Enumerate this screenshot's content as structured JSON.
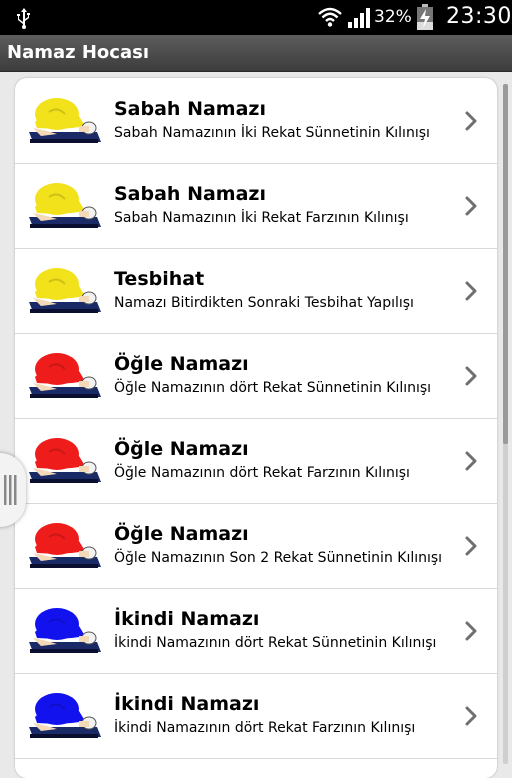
{
  "status_bar": {
    "battery_percent": "32%",
    "time": "23:30",
    "icons": [
      "usb-icon",
      "wifi-icon",
      "signal-icon",
      "battery-charging-icon"
    ]
  },
  "app_title": "Namaz Hocası",
  "colors": {
    "sabah": "#f2e21c",
    "ogle": "#ef1c1c",
    "ikindi": "#1212ee"
  },
  "items": [
    {
      "title": "Sabah Namazı",
      "subtitle": "Sabah Namazının İki Rekat Sünnetinin Kılınışı",
      "color": "#f2e21c"
    },
    {
      "title": "Sabah Namazı",
      "subtitle": "Sabah Namazının İki Rekat Farzının Kılınışı",
      "color": "#f2e21c"
    },
    {
      "title": "Tesbihat",
      "subtitle": "Namazı Bitirdikten Sonraki Tesbihat Yapılışı",
      "color": "#f2e21c"
    },
    {
      "title": "Öğle Namazı",
      "subtitle": "Öğle Namazının dört Rekat Sünnetinin Kılınışı",
      "color": "#ef1c1c"
    },
    {
      "title": "Öğle Namazı",
      "subtitle": "Öğle Namazının dört Rekat Farzının Kılınışı",
      "color": "#ef1c1c"
    },
    {
      "title": "Öğle Namazı",
      "subtitle": "Öğle Namazının Son 2 Rekat Sünnetinin Kılınışı",
      "color": "#ef1c1c"
    },
    {
      "title": "İkindi Namazı",
      "subtitle": "İkindi Namazının dört Rekat Sünnetinin Kılınışı",
      "color": "#1212ee"
    },
    {
      "title": "İkindi Namazı",
      "subtitle": "İkindi Namazının dört Rekat Farzının Kılınışı",
      "color": "#1212ee"
    }
  ]
}
